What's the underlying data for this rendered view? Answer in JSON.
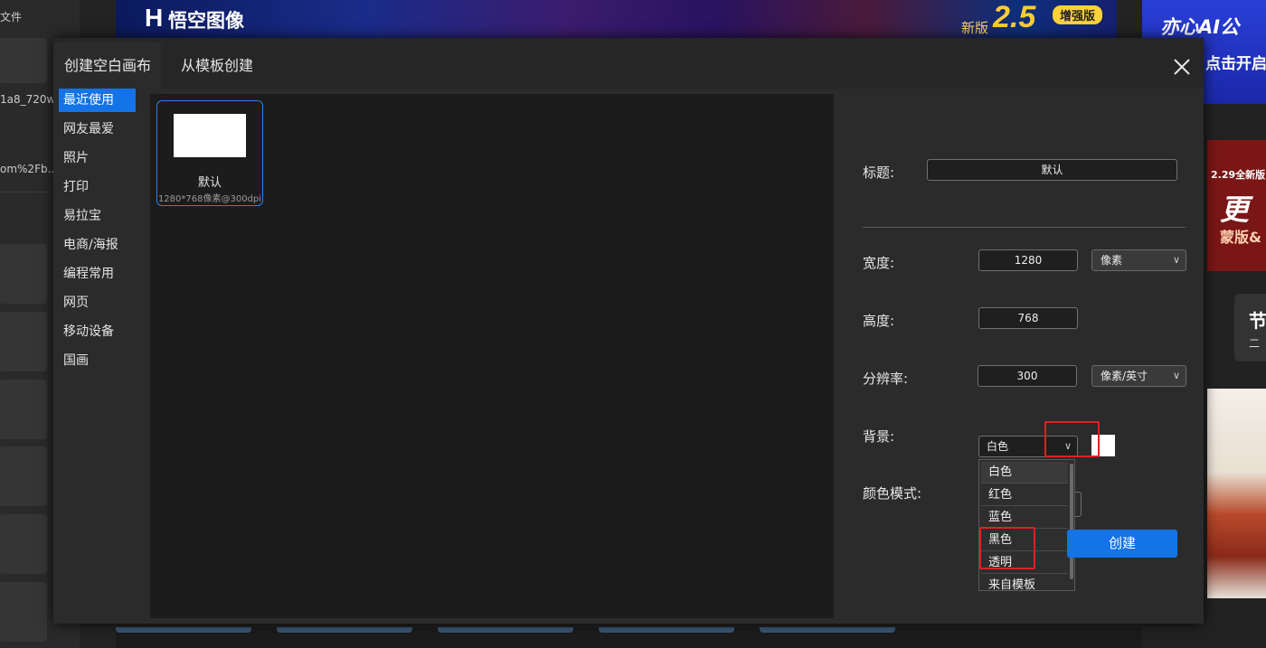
{
  "background_app": {
    "left_panel": {
      "file_label": "文件",
      "file_names": [
        "1a8_720w",
        "om%2Fb.."
      ]
    },
    "banner": {
      "logo_mark": "H",
      "logo_text": "悟空图像",
      "version_prefix": "新版",
      "version": "2.5",
      "version_badge": "增强版"
    },
    "ads": {
      "ad1_line1": "亦心AI公",
      "ad1_line2": "点击开启",
      "ad2_line1": "2.29全新版",
      "ad2_line2": "更",
      "ad2_line3": "蒙版&",
      "ad3_line1": "节",
      "ad3_line2": "二"
    }
  },
  "dialog": {
    "tabs": [
      {
        "label": "创建空白画布",
        "active": true
      },
      {
        "label": "从模板创建",
        "active": false
      }
    ],
    "close_icon": "close-icon",
    "categories": [
      {
        "label": "最近使用",
        "active": true
      },
      {
        "label": "网友最爱"
      },
      {
        "label": "照片"
      },
      {
        "label": "打印"
      },
      {
        "label": "易拉宝"
      },
      {
        "label": "电商/海报"
      },
      {
        "label": "编程常用"
      },
      {
        "label": "网页"
      },
      {
        "label": "移动设备"
      },
      {
        "label": "国画"
      }
    ],
    "templates": [
      {
        "name": "默认",
        "meta": "1280*768像素@300dpi",
        "selected": true
      }
    ],
    "form": {
      "title_label": "标题:",
      "title_value": "默认",
      "width_label": "宽度:",
      "width_value": "1280",
      "width_unit": "像素",
      "height_label": "高度:",
      "height_value": "768",
      "resolution_label": "分辨率:",
      "resolution_value": "300",
      "resolution_unit": "像素/英寸",
      "background_label": "背景:",
      "background_value": "白色",
      "background_swatch_color": "#ffffff",
      "background_options": [
        "白色",
        "红色",
        "蓝色",
        "黑色",
        "透明",
        "来自模板"
      ],
      "color_mode_label": "颜色模式:",
      "create_button": "创建"
    },
    "colors": {
      "accent": "#1473e6",
      "highlight": "#e02020"
    }
  }
}
